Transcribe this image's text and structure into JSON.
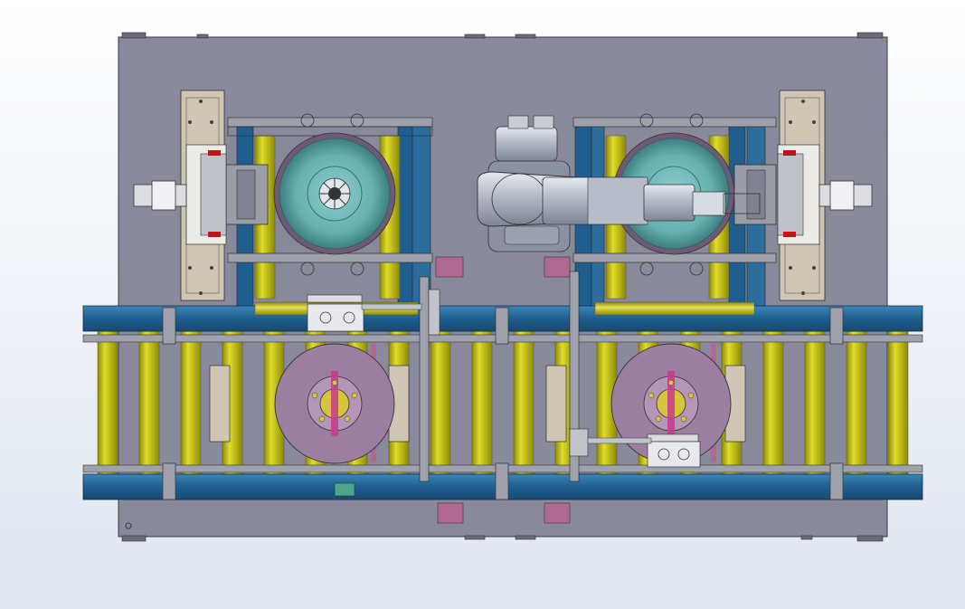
{
  "viewport": {
    "title": ""
  },
  "colors": {
    "background_top": "#ffffff",
    "background_bottom": "#dfe6ef",
    "base_plate": "#888a9c",
    "frame_outline": "#3a3a44",
    "conveyor_rail": "#1f5f8f",
    "conveyor_rail_light": "#3a86b8",
    "roller_yellow": "#c9c40a",
    "roller_shadow": "#8d8a05",
    "rotor_pink": "#9c7ea0",
    "rotor_pink_dark": "#5f4a66",
    "drum_teal": "#66b0b0",
    "drum_teal_dark": "#3e7f80",
    "bracket_beige": "#cfc7b4",
    "robot_silver": "#b9c0cc",
    "robot_dark": "#6f7684",
    "accent_red": "#c0141c",
    "mount_pink": "#b06a8f"
  },
  "components": {
    "base_plate": "base-plate",
    "conveyor": "roller-conveyor",
    "brake_discs": [
      "brake-disc-left",
      "brake-disc-right"
    ],
    "test_drums": [
      "test-drum-left",
      "test-drum-right"
    ],
    "robot_arm": "robot-arm",
    "end_fixtures": [
      "end-fixture-left",
      "end-fixture-right"
    ]
  }
}
